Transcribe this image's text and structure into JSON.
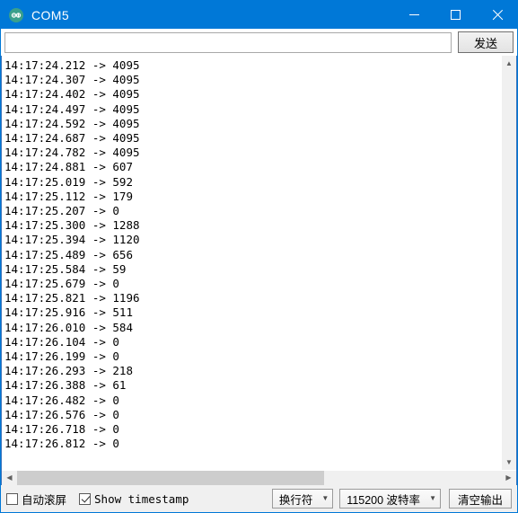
{
  "window": {
    "title": "COM5",
    "app_icon": "arduino-infinity-icon",
    "controls": {
      "minimize": "minimize-icon",
      "maximize": "maximize-icon",
      "close": "close-icon"
    }
  },
  "send_row": {
    "input_value": "",
    "input_placeholder": "",
    "send_label": "发送"
  },
  "console": {
    "lines": [
      "14:17:24.212 -> 4095",
      "14:17:24.307 -> 4095",
      "14:17:24.402 -> 4095",
      "14:17:24.497 -> 4095",
      "14:17:24.592 -> 4095",
      "14:17:24.687 -> 4095",
      "14:17:24.782 -> 4095",
      "14:17:24.881 -> 607",
      "14:17:25.019 -> 592",
      "14:17:25.112 -> 179",
      "14:17:25.207 -> 0",
      "14:17:25.300 -> 1288",
      "14:17:25.394 -> 1120",
      "14:17:25.489 -> 656",
      "14:17:25.584 -> 59",
      "14:17:25.679 -> 0",
      "14:17:25.821 -> 1196",
      "14:17:25.916 -> 511",
      "14:17:26.010 -> 584",
      "14:17:26.104 -> 0",
      "14:17:26.199 -> 0",
      "14:17:26.293 -> 218",
      "14:17:26.388 -> 61",
      "14:17:26.482 -> 0",
      "14:17:26.576 -> 0",
      "14:17:26.718 -> 0",
      "14:17:26.812 -> 0"
    ],
    "scroll_up_icon": "chevron-up-icon",
    "scroll_down_icon": "chevron-down-icon",
    "scroll_left_icon": "chevron-left-icon",
    "scroll_right_icon": "chevron-right-icon"
  },
  "statusbar": {
    "autoscroll_label": "自动滚屏",
    "autoscroll_checked": false,
    "timestamp_label": "Show timestamp",
    "timestamp_checked": true,
    "line_ending": "换行符",
    "baud_rate": "115200 波特率",
    "clear_label": "清空输出",
    "caret_icon": "chevron-down-icon"
  },
  "colors": {
    "titlebar": "#0078d7",
    "border": "#0078d7",
    "console_bg": "#ffffff",
    "status_bg": "#f0f0f0",
    "text": "#000000"
  }
}
